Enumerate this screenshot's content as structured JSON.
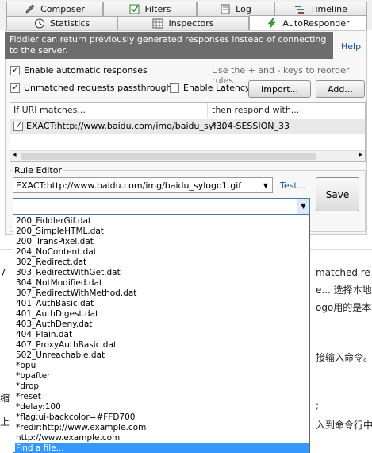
{
  "tabs": {
    "row1": [
      {
        "label": "Composer",
        "icon": "pencil-icon"
      },
      {
        "label": "Filters",
        "icon": "checkbox-icon"
      },
      {
        "label": "Log",
        "icon": "document-icon"
      },
      {
        "label": "Timeline",
        "icon": "timeline-icon"
      }
    ],
    "row2": [
      {
        "label": "Statistics",
        "icon": "clock-icon"
      },
      {
        "label": "Inspectors",
        "icon": "grid-icon"
      },
      {
        "label": "AutoResponder",
        "icon": "lightning-icon"
      }
    ]
  },
  "banner": {
    "text": "Fiddler can return previously generated responses instead of connecting to the server."
  },
  "help_label": "Help",
  "options": {
    "enable_auto": {
      "label": "Enable automatic responses",
      "checked": true
    },
    "passthrough": {
      "label": "Unmatched requests passthrough",
      "checked": true
    },
    "latency": {
      "label": "Enable Latency",
      "checked": false
    }
  },
  "hint": "Use the + and - keys to reorder rules.",
  "import_label": "Import...",
  "add_label": "Add...",
  "list": {
    "col_match": "If URI matches...",
    "col_respond": "then respond with...",
    "rows": [
      {
        "checked": true,
        "match": "EXACT:http://www.baidu.com/img/baidu_syl...",
        "respond": "*304-SESSION_33"
      }
    ]
  },
  "rule_editor": {
    "label": "Rule Editor",
    "match_value": "EXACT:http://www.baidu.com/img/baidu_sylogo1.gif",
    "test_label": "Test...",
    "save_label": "Save",
    "response_value": ""
  },
  "dropdown_items": [
    "200_FiddlerGif.dat",
    "200_SimpleHTML.dat",
    "200_TransPixel.dat",
    "204_NoContent.dat",
    "302_Redirect.dat",
    "303_RedirectWithGet.dat",
    "304_NotModified.dat",
    "307_RedirectWithMethod.dat",
    "401_AuthBasic.dat",
    "401_AuthDigest.dat",
    "403_AuthDeny.dat",
    "404_Plain.dat",
    "407_ProxyAuthBasic.dat",
    "502_Unreachable.dat",
    "*bpu",
    "*bpafter",
    "*drop",
    "*reset",
    "*delay:100",
    "*flag:ui-backcolor=#FFD700",
    "*redir:http://www.example.com",
    "http://www.example.com",
    "Find a file..."
  ],
  "background_text": [
    "matched re",
    "e... 选择本地",
    "ogo用的是本",
    "接输入命令。",
    ";",
    "入到命令行中",
    "7",
    "缩",
    "上"
  ],
  "colors": {
    "selection": "#3399ff",
    "banner": "#6d6d6d",
    "link": "#1a4f9c"
  }
}
